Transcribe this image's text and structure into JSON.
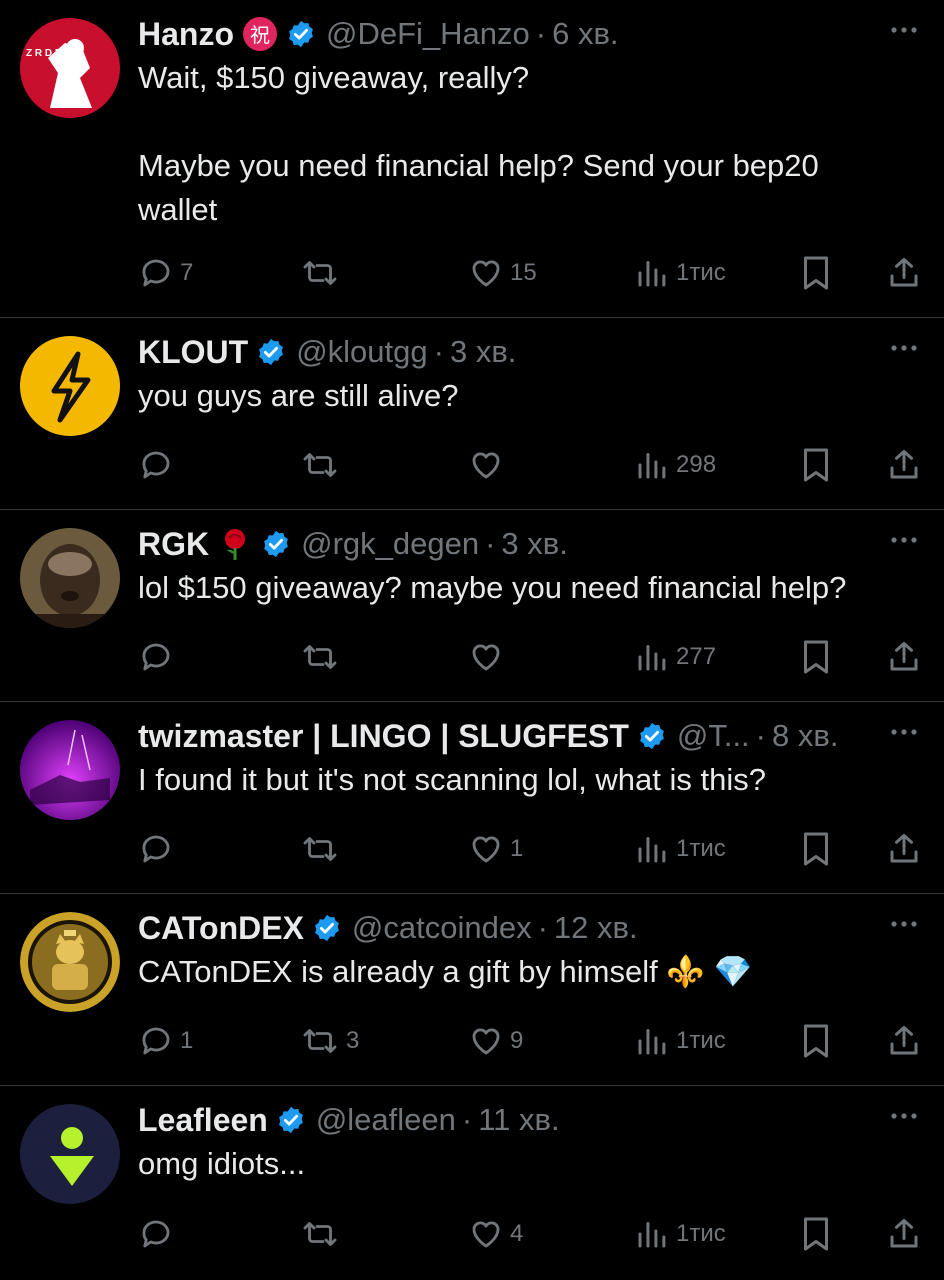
{
  "colors": {
    "background": "#000000",
    "text": "#e7e9ea",
    "muted": "#71767b",
    "verified": "#1d9bf0",
    "divider": "#2f3336"
  },
  "tweets": [
    {
      "name": "Hanzo",
      "name_emoji": "祝",
      "handle": "@DeFi_Hanzo",
      "time": "6 хв.",
      "text": [
        "Wait, $150 giveaway, really?",
        "",
        "Maybe you need financial help? Send your bep20",
        "wallet"
      ],
      "replies": "7",
      "retweets": "",
      "likes": "15",
      "views": "1тис",
      "avatar_icon": "samurai-avatar",
      "avatar_text": "Z R D R O"
    },
    {
      "name": "KLOUT",
      "handle": "@kloutgg",
      "time": "3 хв.",
      "text": [
        "you guys are still alive?"
      ],
      "replies": "",
      "retweets": "",
      "likes": "",
      "views": "298",
      "avatar_icon": "lightning-bolt-avatar"
    },
    {
      "name": "RGK",
      "name_emoji": "🌹",
      "handle": "@rgk_degen",
      "time": "3 хв.",
      "text": [
        "lol $150 giveaway? maybe you need financial help?"
      ],
      "replies": "",
      "retweets": "",
      "likes": "",
      "views": "277",
      "avatar_icon": "face-photo-avatar"
    },
    {
      "name": "twizmaster | LINGO | SLUGFEST",
      "handle": "@T...",
      "time": "8 хв.",
      "text": [
        "I found it but it's not scanning lol, what is this?"
      ],
      "replies": "",
      "retweets": "",
      "likes": "1",
      "views": "1тис",
      "avatar_icon": "purple-scene-avatar"
    },
    {
      "name": "CATonDEX",
      "handle": "@catcoindex",
      "time": "12 хв.",
      "text": [
        "CATonDEX is already a gift by himself ⚜️ 💎"
      ],
      "replies": "1",
      "retweets": "3",
      "likes": "9",
      "views": "1тис",
      "avatar_icon": "gold-cat-coin-avatar"
    },
    {
      "name": "Leafleen",
      "handle": "@leafleen",
      "time": "11 хв.",
      "text": [
        "omg idiots..."
      ],
      "replies": "",
      "retweets": "",
      "likes": "4",
      "views": "1тис",
      "avatar_icon": "green-arrow-avatar"
    }
  ]
}
